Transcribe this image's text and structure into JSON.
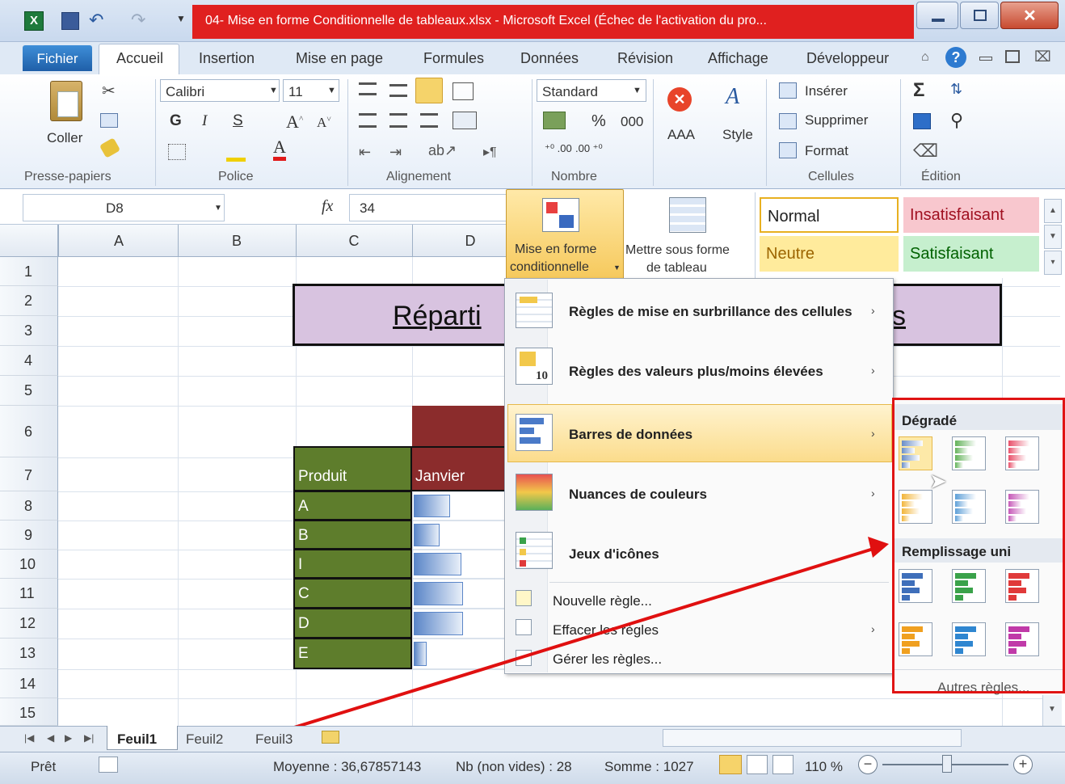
{
  "window": {
    "title": "04- Mise en forme Conditionnelle de tableaux.xlsx  -  Microsoft Excel (Échec de l'activation du pro..."
  },
  "tabs": [
    "Fichier",
    "Accueil",
    "Insertion",
    "Mise en page",
    "Formules",
    "Données",
    "Révision",
    "Affichage",
    "Développeur"
  ],
  "ribbon": {
    "paste": "Coller",
    "font_name": "Calibri",
    "font_size": "11",
    "bold": "G",
    "italic": "I",
    "underline": "S",
    "number_format": "Standard",
    "percent": "%",
    "thousands": "000",
    "aaa": "AAA",
    "style": "Style",
    "insert": "Insérer",
    "delete": "Supprimer",
    "format": "Format",
    "groups": {
      "clipboard": "Presse-papiers",
      "font": "Police",
      "alignment": "Alignement",
      "number": "Nombre",
      "cells": "Cellules",
      "editing": "Édition"
    },
    "cf_button": [
      "Mise en forme",
      "conditionnelle"
    ],
    "table_button": [
      "Mettre sous forme",
      "de tableau"
    ],
    "styles": {
      "normal": "Normal",
      "bad": "Insatisfaisant",
      "neutral": "Neutre",
      "good": "Satisfaisant"
    }
  },
  "formula": {
    "cell_ref": "D8",
    "fx": "fx",
    "value": "34"
  },
  "columns": [
    "A",
    "B",
    "C",
    "D"
  ],
  "rows": [
    "1",
    "2",
    "3",
    "4",
    "5",
    "6",
    "7",
    "8",
    "9",
    "10",
    "11",
    "12",
    "13",
    "14",
    "15"
  ],
  "sheet": {
    "title_fragment": "Réparti",
    "title_tail": "s",
    "header_product": "Produit",
    "header_month": "Janvier",
    "products": [
      "A",
      "B",
      "I",
      "C",
      "D",
      "E"
    ],
    "bar_fill": [
      0.34,
      0.24,
      0.45,
      0.46,
      0.46,
      0.12
    ]
  },
  "menu": {
    "items": [
      {
        "label": "Règles de mise en surbrillance des cellules",
        "arrow": "›"
      },
      {
        "label": "Règles des valeurs plus/moins élevées",
        "arrow": "›"
      },
      {
        "label": "Barres de données",
        "arrow": "›"
      },
      {
        "label": "Nuances de couleurs",
        "arrow": "›"
      },
      {
        "label": "Jeux d'icônes"
      }
    ],
    "commands": [
      {
        "label": "Nouvelle règle..."
      },
      {
        "label": "Effacer les règles",
        "arrow": "›"
      },
      {
        "label": "Gérer les règles..."
      }
    ]
  },
  "submenu": {
    "gradient_title": "Dégradé",
    "solid_title": "Remplissage uni",
    "more": "Autres règles...",
    "gradient_colors": [
      "#6a8ec8",
      "#63b25a",
      "#e8506a",
      "#f2b53a",
      "#5fa0d8",
      "#c659b8"
    ],
    "solid_colors": [
      "#3f6fba",
      "#3aa24a",
      "#e03a3a",
      "#f0a020",
      "#2f86d0",
      "#c03aa8"
    ]
  },
  "sheets": [
    "Feuil1",
    "Feuil2",
    "Feuil3"
  ],
  "status": {
    "ready": "Prêt",
    "average": "Moyenne : 36,67857143",
    "count": "Nb (non vides) : 28",
    "sum": "Somme : 1027",
    "zoom": "110 %"
  }
}
